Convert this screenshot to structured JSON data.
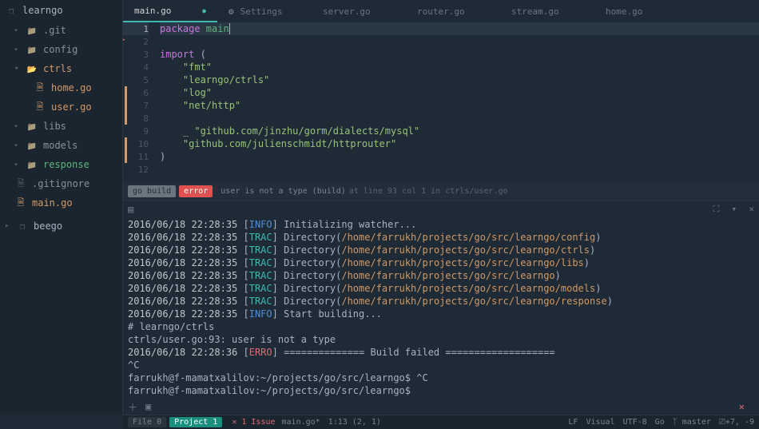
{
  "sidebar": {
    "project": "learngo",
    "items": [
      {
        "label": ".git",
        "type": "folder",
        "depth": 1
      },
      {
        "label": "config",
        "type": "folder",
        "depth": 1
      },
      {
        "label": "ctrls",
        "type": "folder",
        "depth": 1,
        "expanded": true,
        "active": true
      },
      {
        "label": "home.go",
        "type": "file",
        "depth": 2,
        "highlight": true
      },
      {
        "label": "user.go",
        "type": "file",
        "depth": 2,
        "highlight": true
      },
      {
        "label": "libs",
        "type": "folder",
        "depth": 1
      },
      {
        "label": "models",
        "type": "folder",
        "depth": 1
      },
      {
        "label": "response",
        "type": "folder",
        "depth": 1,
        "green": true
      },
      {
        "label": ".gitignore",
        "type": "file",
        "depth": 1,
        "muted": true
      },
      {
        "label": "main.go",
        "type": "file",
        "depth": 1,
        "highlight": true
      }
    ],
    "secondary": {
      "label": "beego"
    }
  },
  "tabs": [
    {
      "label": "main.go",
      "active": true,
      "modified": true
    },
    {
      "label": "Settings",
      "icon": "gear"
    },
    {
      "label": "server.go"
    },
    {
      "label": "router.go"
    },
    {
      "label": "stream.go"
    },
    {
      "label": "home.go"
    }
  ],
  "editor": {
    "lines": [
      {
        "n": 1,
        "current": true,
        "tokens": [
          {
            "t": "package ",
            "c": "kw"
          },
          {
            "t": "main",
            "c": "pkg"
          }
        ]
      },
      {
        "n": 2,
        "tokens": []
      },
      {
        "n": 3,
        "tokens": [
          {
            "t": "import ",
            "c": "kw"
          },
          {
            "t": "(",
            "c": ""
          }
        ]
      },
      {
        "n": 4,
        "tokens": [
          {
            "t": "    ",
            "c": ""
          },
          {
            "t": "\"fmt\"",
            "c": "str"
          }
        ]
      },
      {
        "n": 5,
        "tokens": [
          {
            "t": "    ",
            "c": ""
          },
          {
            "t": "\"learngo/ctrls\"",
            "c": "str"
          }
        ]
      },
      {
        "n": 6,
        "tokens": [
          {
            "t": "    ",
            "c": ""
          },
          {
            "t": "\"log\"",
            "c": "str"
          }
        ]
      },
      {
        "n": 7,
        "tokens": [
          {
            "t": "    ",
            "c": ""
          },
          {
            "t": "\"net/http\"",
            "c": "str"
          }
        ]
      },
      {
        "n": 8,
        "tokens": []
      },
      {
        "n": 9,
        "tokens": [
          {
            "t": "    _ ",
            "c": ""
          },
          {
            "t": "\"github.com/jinzhu/gorm/dialects/mysql\"",
            "c": "str"
          }
        ]
      },
      {
        "n": 10,
        "tokens": [
          {
            "t": "    ",
            "c": ""
          },
          {
            "t": "\"github.com/julienschmidt/httprouter\"",
            "c": "str"
          }
        ]
      },
      {
        "n": 11,
        "tokens": [
          {
            "t": ")",
            "c": ""
          }
        ]
      },
      {
        "n": 12,
        "tokens": []
      }
    ]
  },
  "lint": {
    "build_label": "go build",
    "error_label": "error",
    "message": "user is not a type (build)",
    "location": "at line 93 col 1 in ctrls/user.go"
  },
  "terminal": {
    "lines": [
      {
        "ts": "2016/06/18 22:28:35",
        "lv": "INFO",
        "pre": "Initializing watcher...",
        "path": ""
      },
      {
        "ts": "2016/06/18 22:28:35",
        "lv": "TRAC",
        "pre": "Directory(",
        "path": "/home/farrukh/projects/go/src/learngo/config",
        "suf": ")"
      },
      {
        "ts": "2016/06/18 22:28:35",
        "lv": "TRAC",
        "pre": "Directory(",
        "path": "/home/farrukh/projects/go/src/learngo/ctrls",
        "suf": ")"
      },
      {
        "ts": "2016/06/18 22:28:35",
        "lv": "TRAC",
        "pre": "Directory(",
        "path": "/home/farrukh/projects/go/src/learngo/libs",
        "suf": ")"
      },
      {
        "ts": "2016/06/18 22:28:35",
        "lv": "TRAC",
        "pre": "Directory(",
        "path": "/home/farrukh/projects/go/src/learngo",
        "suf": ")"
      },
      {
        "ts": "2016/06/18 22:28:35",
        "lv": "TRAC",
        "pre": "Directory(",
        "path": "/home/farrukh/projects/go/src/learngo/models",
        "suf": ")"
      },
      {
        "ts": "2016/06/18 22:28:35",
        "lv": "TRAC",
        "pre": "Directory(",
        "path": "/home/farrukh/projects/go/src/learngo/response",
        "suf": ")"
      },
      {
        "ts": "2016/06/18 22:28:35",
        "lv": "INFO",
        "pre": "Start building...",
        "path": ""
      },
      {
        "plain": "# learngo/ctrls"
      },
      {
        "plain": "ctrls/user.go:93: user is not a type"
      },
      {
        "ts": "2016/06/18 22:28:36",
        "lv": "ERRO",
        "pre": "============== Build failed ===================",
        "path": ""
      },
      {
        "plain": "^C"
      },
      {
        "plain": "farrukh@f-mamatxalilov:~/projects/go/src/learngo$ ^C"
      },
      {
        "plain": "farrukh@f-mamatxalilov:~/projects/go/src/learngo$ "
      }
    ]
  },
  "status": {
    "file_pill": "File 0",
    "project_pill": "Project 1",
    "issues": "1 Issue",
    "filename": "main.go*",
    "cursor": "1:13",
    "selection": "(2, 1)",
    "right": {
      "line_ending": "LF",
      "mode": "Visual",
      "encoding": "UTF-8",
      "lang": "Go",
      "branch": "master",
      "position": "+7, -9"
    }
  }
}
